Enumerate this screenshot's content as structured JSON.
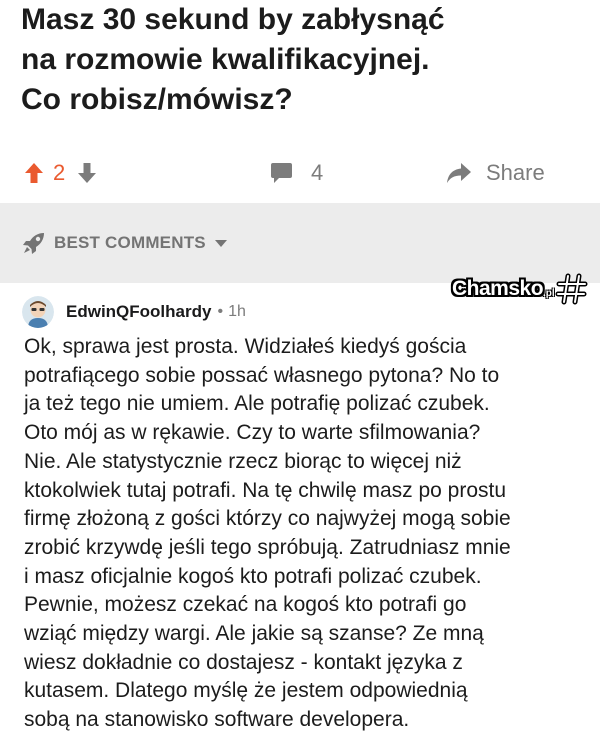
{
  "post": {
    "title": "Masz 30 sekund by zabłysnąć\nna rozmowie kwalifikacyjnej.\nCo robisz/mówisz?"
  },
  "actions": {
    "vote_count": "2",
    "comment_count": "4",
    "share_label": "Share"
  },
  "sort": {
    "label": "BEST COMMENTS"
  },
  "watermark": {
    "name": "Chamsko",
    "suffix": ".pl"
  },
  "comment": {
    "author": "EdwinQFoolhardy",
    "separator": "•",
    "time": "1h",
    "body": "Ok, sprawa jest prosta. Widziałeś kiedyś gościa\npotrafiącego sobie possać własnego pytona? No to\nja też tego nie umiem. Ale potrafię polizać czubek.\nOto mój as w rękawie. Czy to warte sfilmowania?\nNie. Ale statystycznie rzecz biorąc to więcej niż\nktokolwiek tutaj potrafi. Na tę chwilę masz po prostu\nfirmę złożoną z gości którzy co najwyżej mogą sobie\nzrobić krzywdę jeśli tego spróbują. Zatrudniasz mnie\ni masz oficjalnie kogoś kto potrafi polizać czubek.\nPewnie, możesz czekać na kogoś kto potrafi go\nwziąć między wargi. Ale jakie są szanse? Ze mną\nwiesz dokładnie co dostajesz - kontakt języka z\nkutasem. Dlatego myślę że jestem odpowiednią\nsobą na stanowisko software developera."
  },
  "colors": {
    "upvote_active": "#ea5a2f",
    "icon_gray": "#7c7c7c",
    "sort_band_bg": "#ececec",
    "text_primary": "#1c1c1c"
  },
  "icons": {
    "upvote": "arrow-up-icon",
    "downvote": "arrow-down-icon",
    "comments": "speech-bubble-icon",
    "share": "share-arrow-icon",
    "sort": "rocket-icon",
    "sort_toggle": "chevron-down-icon",
    "watermark": "hash-icon"
  }
}
